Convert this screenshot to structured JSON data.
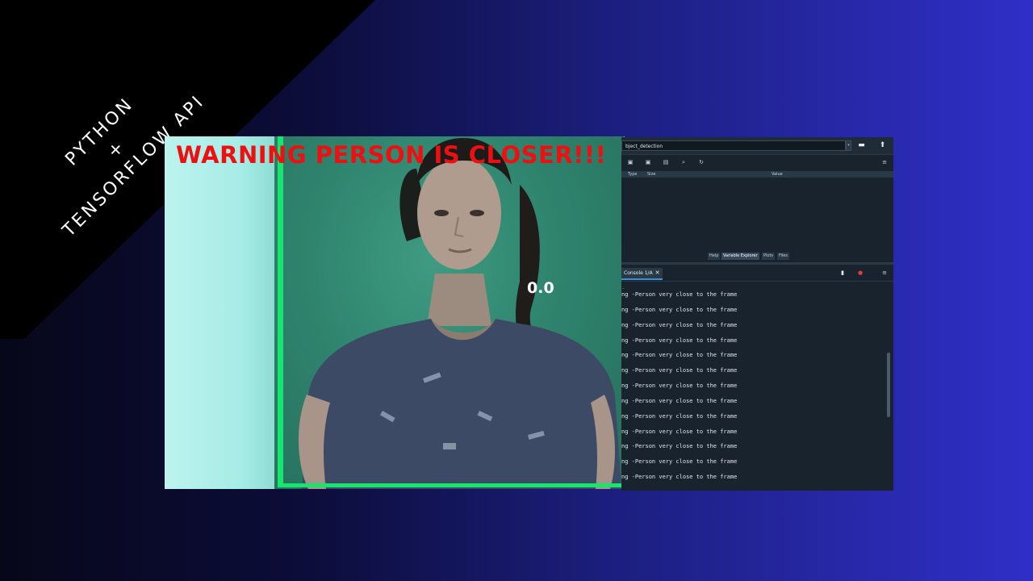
{
  "banner": {
    "line1": "PYTHON",
    "line2": "+",
    "line3": "TENSORFLOW API"
  },
  "camera": {
    "warning_text": "WARNING PERSON IS CLOSER!!!",
    "score_text": "0.0",
    "box_color": "#16e66e",
    "warning_color": "#ee1010"
  },
  "ide": {
    "path_value": "bject_detection",
    "pane_tabs": [
      "Help",
      "Variable Explorer",
      "Plots",
      "Files"
    ],
    "active_pane_tab": "Variable Explorer",
    "var_columns": [
      "Type",
      "Size",
      "Value"
    ],
    "console_tab_label": "Console 1/A",
    "console_lines": [
      "ng -Person very close to the frame",
      "ng -Person very close to the frame",
      "ng -Person very close to the frame",
      "ng -Person very close to the frame",
      "ng -Person very close to the frame",
      "ng -Person very close to the frame",
      "ng -Person very close to the frame",
      "ng -Person very close to the frame",
      "ng -Person very close to the frame",
      "ng -Person very close to the frame",
      "ng -Person very close to the frame",
      "ng -Person very close to the frame",
      "ng -Person very close to the frame"
    ]
  }
}
